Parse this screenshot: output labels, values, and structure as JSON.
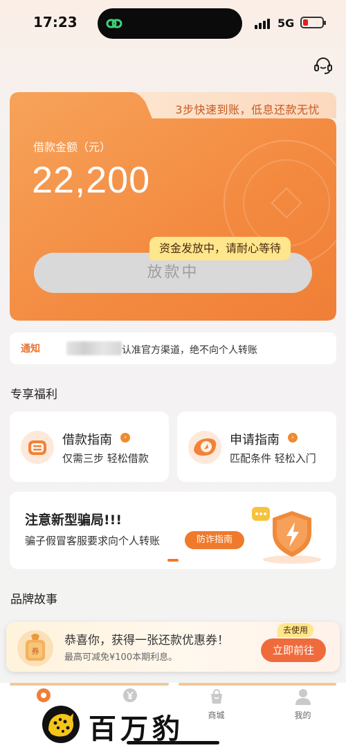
{
  "status_bar": {
    "time": "17:23",
    "network": "5G"
  },
  "loan_card": {
    "tagline": "3步快速到账，低息还款无忧",
    "amount_label": "借款金额（元）",
    "amount": "22,200",
    "tooltip": "资金发放中，请耐心等待",
    "button_label": "放款中"
  },
  "notice": {
    "tag": "通知",
    "text": "认准官方渠道，绝不向个人转账"
  },
  "sections": {
    "benefits_title": "专享福利",
    "brand_title": "品牌故事"
  },
  "benefits": [
    {
      "title": "借款指南",
      "subtitle": "仅需三步  轻松借款",
      "icon": "loan-guide-icon"
    },
    {
      "title": "申请指南",
      "subtitle": "匹配条件  轻松入门",
      "icon": "apply-guide-icon"
    }
  ],
  "fraud_banner": {
    "title": "注意新型骗局!!!",
    "subtitle": "骗子假冒客服要求向个人转账",
    "button_label": "防诈指南"
  },
  "coupon": {
    "title": "恭喜你，获得一张还款优惠券！",
    "subtitle": "最高可减免¥100本期利息。",
    "badge": "去使用",
    "button_label": "立即前往"
  },
  "bottom_nav": [
    {
      "label": "",
      "icon": "home-icon"
    },
    {
      "label": "",
      "icon": "loan-icon"
    },
    {
      "label": "商城",
      "icon": "mall-icon"
    },
    {
      "label": "我的",
      "icon": "profile-icon"
    }
  ],
  "watermark": {
    "text": "百万豹"
  },
  "colors": {
    "accent": "#ef7a2c",
    "card_gradient_start": "#f7a35a",
    "card_gradient_end": "#f07f36",
    "tooltip_bg": "#fde68b",
    "coupon_button": "#f06b3c"
  }
}
